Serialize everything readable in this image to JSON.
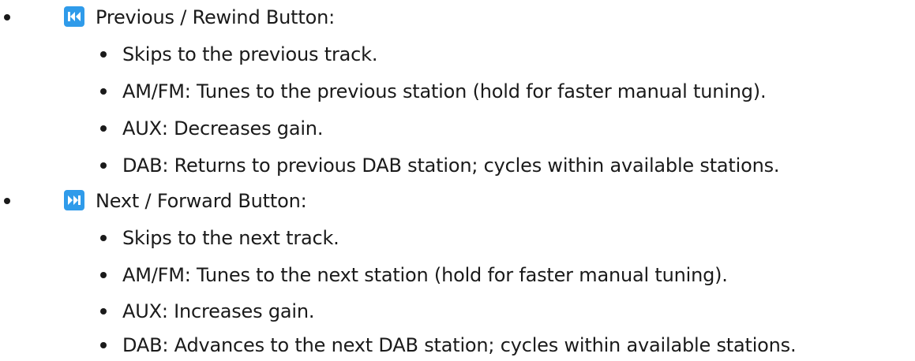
{
  "sections": [
    {
      "icon": "skip-previous-icon",
      "icon_color": "#2f9bea",
      "heading": "Previous / Rewind Button:",
      "items": [
        "Skips to the previous track.",
        "AM/FM: Tunes to the previous station (hold for faster manual tuning).",
        "AUX: Decreases gain.",
        "DAB: Returns to previous DAB station; cycles within available stations."
      ]
    },
    {
      "icon": "skip-next-icon",
      "icon_color": "#2f9bea",
      "heading": "Next / Forward Button:",
      "items": [
        "Skips to the next track.",
        "AM/FM: Tunes to the next station (hold for faster manual tuning).",
        "AUX: Increases gain.",
        "DAB: Advances to the next DAB station; cycles within available stations."
      ]
    }
  ]
}
